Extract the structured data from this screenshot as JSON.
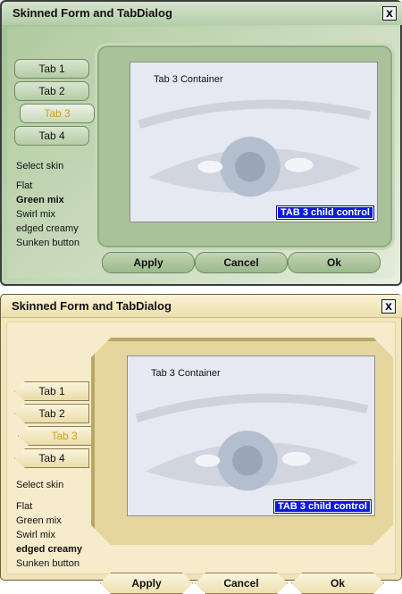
{
  "windows": [
    {
      "skin": "Green mix",
      "title": "Skinned Form and TabDialog",
      "close_symbol": "x",
      "tabs": [
        "Tab 1",
        "Tab 2",
        "Tab 3",
        "Tab 4"
      ],
      "active_tab": "Tab 3",
      "skin_label": "Select skin",
      "skins": [
        "Flat",
        "Green mix",
        "Swirl mix",
        "edged creamy",
        "Sunken button"
      ],
      "selected_skin": "Green mix",
      "container_label": "Tab 3 Container",
      "child_control": "TAB 3 child control",
      "buttons": {
        "apply": "Apply",
        "cancel": "Cancel",
        "ok": "Ok"
      }
    },
    {
      "skin": "edged creamy",
      "title": "Skinned Form and TabDialog",
      "close_symbol": "x",
      "tabs": [
        "Tab 1",
        "Tab 2",
        "Tab 3",
        "Tab 4"
      ],
      "active_tab": "Tab 3",
      "skin_label": "Select skin",
      "skins": [
        "Flat",
        "Green mix",
        "Swirl mix",
        "edged creamy",
        "Sunken button"
      ],
      "selected_skin": "edged creamy",
      "container_label": "Tab 3 Container",
      "child_control": "TAB 3 child control",
      "buttons": {
        "apply": "Apply",
        "cancel": "Cancel",
        "ok": "Ok"
      }
    }
  ],
  "colors": {
    "green_frame": "#b1ca9f",
    "cream_frame": "#f6eccb",
    "active_tab_text": "#d79a23",
    "child_control_bg": "#0c1ae0",
    "child_control_text": "#ffffff"
  },
  "icons": {
    "close": "close-icon",
    "tab_indicator": "tab-indicator-icon",
    "container_image": "eye-photo"
  }
}
